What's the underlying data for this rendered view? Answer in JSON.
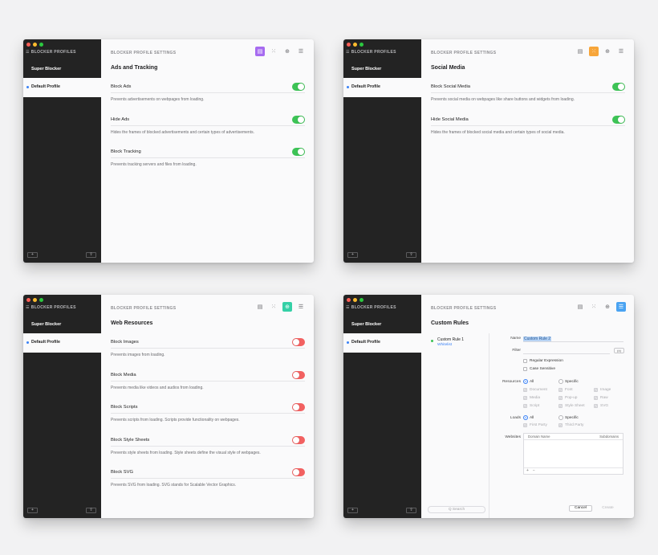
{
  "sidebar": {
    "title": "BLOCKER PROFILES",
    "app_name": "Super Blocker",
    "selected_profile": "Default Profile",
    "add_button": "+",
    "share_button": "⇪"
  },
  "header": {
    "title": "BLOCKER PROFILE SETTINGS"
  },
  "tab_icons": [
    "ads-tab-icon",
    "social-tab-icon",
    "web-resources-tab-icon",
    "custom-rules-tab-icon"
  ],
  "colors": {
    "ads_accent": "#a66bf0",
    "social_accent": "#f7a539",
    "web_accent": "#34d0a6",
    "custom_accent": "#4aa3f2",
    "toggle_on": "#3dc356",
    "toggle_off": "#f26161"
  },
  "ads": {
    "title": "Ads and Tracking",
    "items": [
      {
        "name": "Block Ads",
        "desc": "Prevents advertisements on webpages from loading.",
        "state": "on"
      },
      {
        "name": "Hide Ads",
        "desc": "Hides the frames of blocked advertisements and certain types of advertisements.",
        "state": "on"
      },
      {
        "name": "Block Tracking",
        "desc": "Prevents tracking servers and files from loading.",
        "state": "on"
      }
    ]
  },
  "social": {
    "title": "Social Media",
    "items": [
      {
        "name": "Block Social Media",
        "desc": "Prevents social media on webpages like share buttons and widgets from loading.",
        "state": "on"
      },
      {
        "name": "Hide Social Media",
        "desc": "Hides the frames of blocked social media and certain types of social media.",
        "state": "on"
      }
    ]
  },
  "web": {
    "title": "Web Resources",
    "items": [
      {
        "name": "Block Images",
        "desc": "Prevents images from loading.",
        "state": "off"
      },
      {
        "name": "Block Media",
        "desc": "Prevents media like videos and audios from loading.",
        "state": "off"
      },
      {
        "name": "Block Scripts",
        "desc": "Prevents scripts from loading. Scripts provide functionality on webpages.",
        "state": "off"
      },
      {
        "name": "Block Style Sheets",
        "desc": "Prevents style sheets from loading. Style sheets define the visual style of webpages.",
        "state": "off"
      },
      {
        "name": "Block SVG",
        "desc": "Prevents SVG from loading. SVG stands for Scalable Vector Graphics.",
        "state": "off"
      }
    ]
  },
  "custom": {
    "title": "Custom Rules",
    "rule_name": "Custom Rule 1",
    "rule_type": "Whitelist",
    "search_placeholder": "Q Search",
    "form": {
      "name_label": "Name",
      "name_value": "Custom Rule 2",
      "filter_label": "Filter",
      "regex_button": "(x)",
      "regular_expression": "Regular Expression",
      "case_sensitive": "Case Sensitive",
      "resources_label": "Resources",
      "all_label": "All",
      "specific_label": "Specific",
      "resource_types": [
        "Document",
        "Font",
        "Image",
        "Media",
        "Pop-up",
        "Raw",
        "Script",
        "Style Sheet",
        "SVG"
      ],
      "loads_label": "Loads",
      "load_types": [
        "First Party",
        "Third Party"
      ],
      "websites_label": "Websites",
      "col_domain": "Domain Name",
      "col_subdomains": "Subdomains",
      "table_add": "+",
      "table_remove": "−",
      "cancel_button": "Cancel",
      "create_button": "Create"
    }
  }
}
